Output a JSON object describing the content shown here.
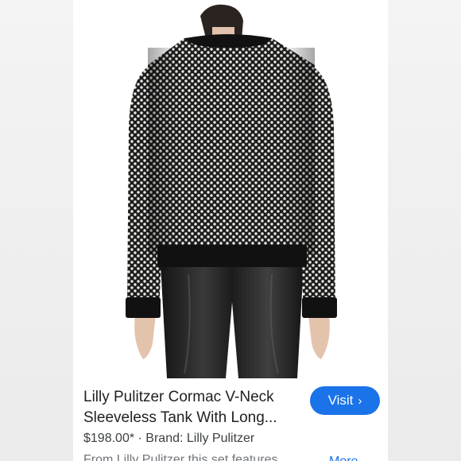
{
  "product": {
    "title_line1": "Lilly Pulitzer Cormac V-Neck",
    "title_line2": "Sleeveless Tank With Long...",
    "price": "$198.00*",
    "separator": "·",
    "brand": "Brand: Lilly Pulitzer",
    "description_partial": "From Lilly Pulitzer this set features",
    "more_label": "More",
    "more_icon": "chevron-down-icon"
  },
  "visit_button": {
    "label": "Visit",
    "icon": "chevron-right-icon",
    "color": "#1a73e8"
  },
  "image": {
    "subject_icon": "model-back-view-photo"
  }
}
